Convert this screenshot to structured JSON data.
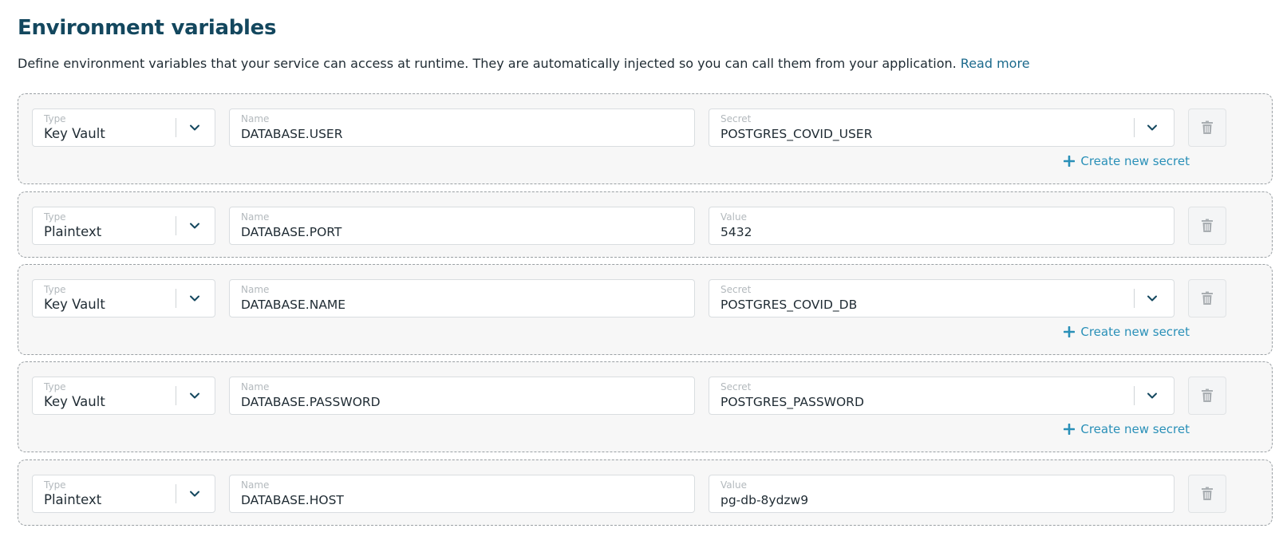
{
  "header": {
    "title": "Environment variables",
    "description": "Define environment variables that your service can access at runtime. They are automatically injected so you can call them from your application.",
    "read_more": "Read more"
  },
  "labels": {
    "type": "Type",
    "name": "Name",
    "secret": "Secret",
    "value": "Value",
    "create_secret": "Create new secret"
  },
  "icons": {
    "dropdown": "chevron-down-icon",
    "delete": "trash-icon",
    "add": "plus-icon"
  },
  "colors": {
    "title": "#13475e",
    "link": "#1c6a8c",
    "accent": "#2a90b8",
    "row_background": "#f7f7f7"
  },
  "variables": [
    {
      "type": "Key Vault",
      "name": "DATABASE.USER",
      "value_label": "Secret",
      "value": "POSTGRES_COVID_USER",
      "is_secret": true
    },
    {
      "type": "Plaintext",
      "name": "DATABASE.PORT",
      "value_label": "Value",
      "value": "5432",
      "is_secret": false
    },
    {
      "type": "Key Vault",
      "name": "DATABASE.NAME",
      "value_label": "Secret",
      "value": "POSTGRES_COVID_DB",
      "is_secret": true
    },
    {
      "type": "Key Vault",
      "name": "DATABASE.PASSWORD",
      "value_label": "Secret",
      "value": "POSTGRES_PASSWORD",
      "is_secret": true
    },
    {
      "type": "Plaintext",
      "name": "DATABASE.HOST",
      "value_label": "Value",
      "value": "pg-db-8ydzw9",
      "is_secret": false
    }
  ]
}
